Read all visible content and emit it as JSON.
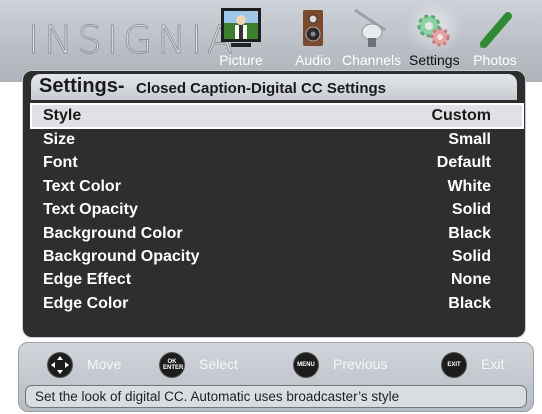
{
  "brand": {
    "logo": "INSIGNIA"
  },
  "nav": [
    {
      "label": "Picture",
      "icon": "picture-icon",
      "active": false
    },
    {
      "label": "Audio",
      "icon": "speaker-icon",
      "active": false
    },
    {
      "label": "Channels",
      "icon": "satellite-dish-icon",
      "active": false
    },
    {
      "label": "Settings",
      "icon": "gears-icon",
      "active": true
    },
    {
      "label": "Photos",
      "icon": "pen-icon",
      "active": false
    }
  ],
  "panel": {
    "title": "Settings-",
    "subtitle": "Closed Caption-Digital CC Settings",
    "rows": [
      {
        "key": "Style",
        "value": "Custom",
        "selected": true
      },
      {
        "key": "Size",
        "value": "Small"
      },
      {
        "key": "Font",
        "value": "Default"
      },
      {
        "key": "Text Color",
        "value": "White"
      },
      {
        "key": "Text Opacity",
        "value": "Solid"
      },
      {
        "key": "Background Color",
        "value": "Black"
      },
      {
        "key": "Background Opacity",
        "value": "Solid"
      },
      {
        "key": "Edge Effect",
        "value": "None"
      },
      {
        "key": "Edge Color",
        "value": "Black"
      }
    ]
  },
  "footer": {
    "buttons": [
      {
        "label": "Move",
        "icon": "dpad-icon",
        "text": ""
      },
      {
        "label": "Select",
        "icon": "ok-enter-icon",
        "text": "OK ENTER"
      },
      {
        "label": "Previous",
        "icon": "menu-button-icon",
        "text": "MENU"
      },
      {
        "label": "Exit",
        "icon": "exit-button-icon",
        "text": "EXIT"
      }
    ],
    "hint": "Set the look of digital CC. Automatic uses broadcaster’s style"
  },
  "colors": {
    "panel_bg": "#2e2e2e",
    "header_bg": "#c1c5cb",
    "selected_row": "#dfe1e4"
  }
}
